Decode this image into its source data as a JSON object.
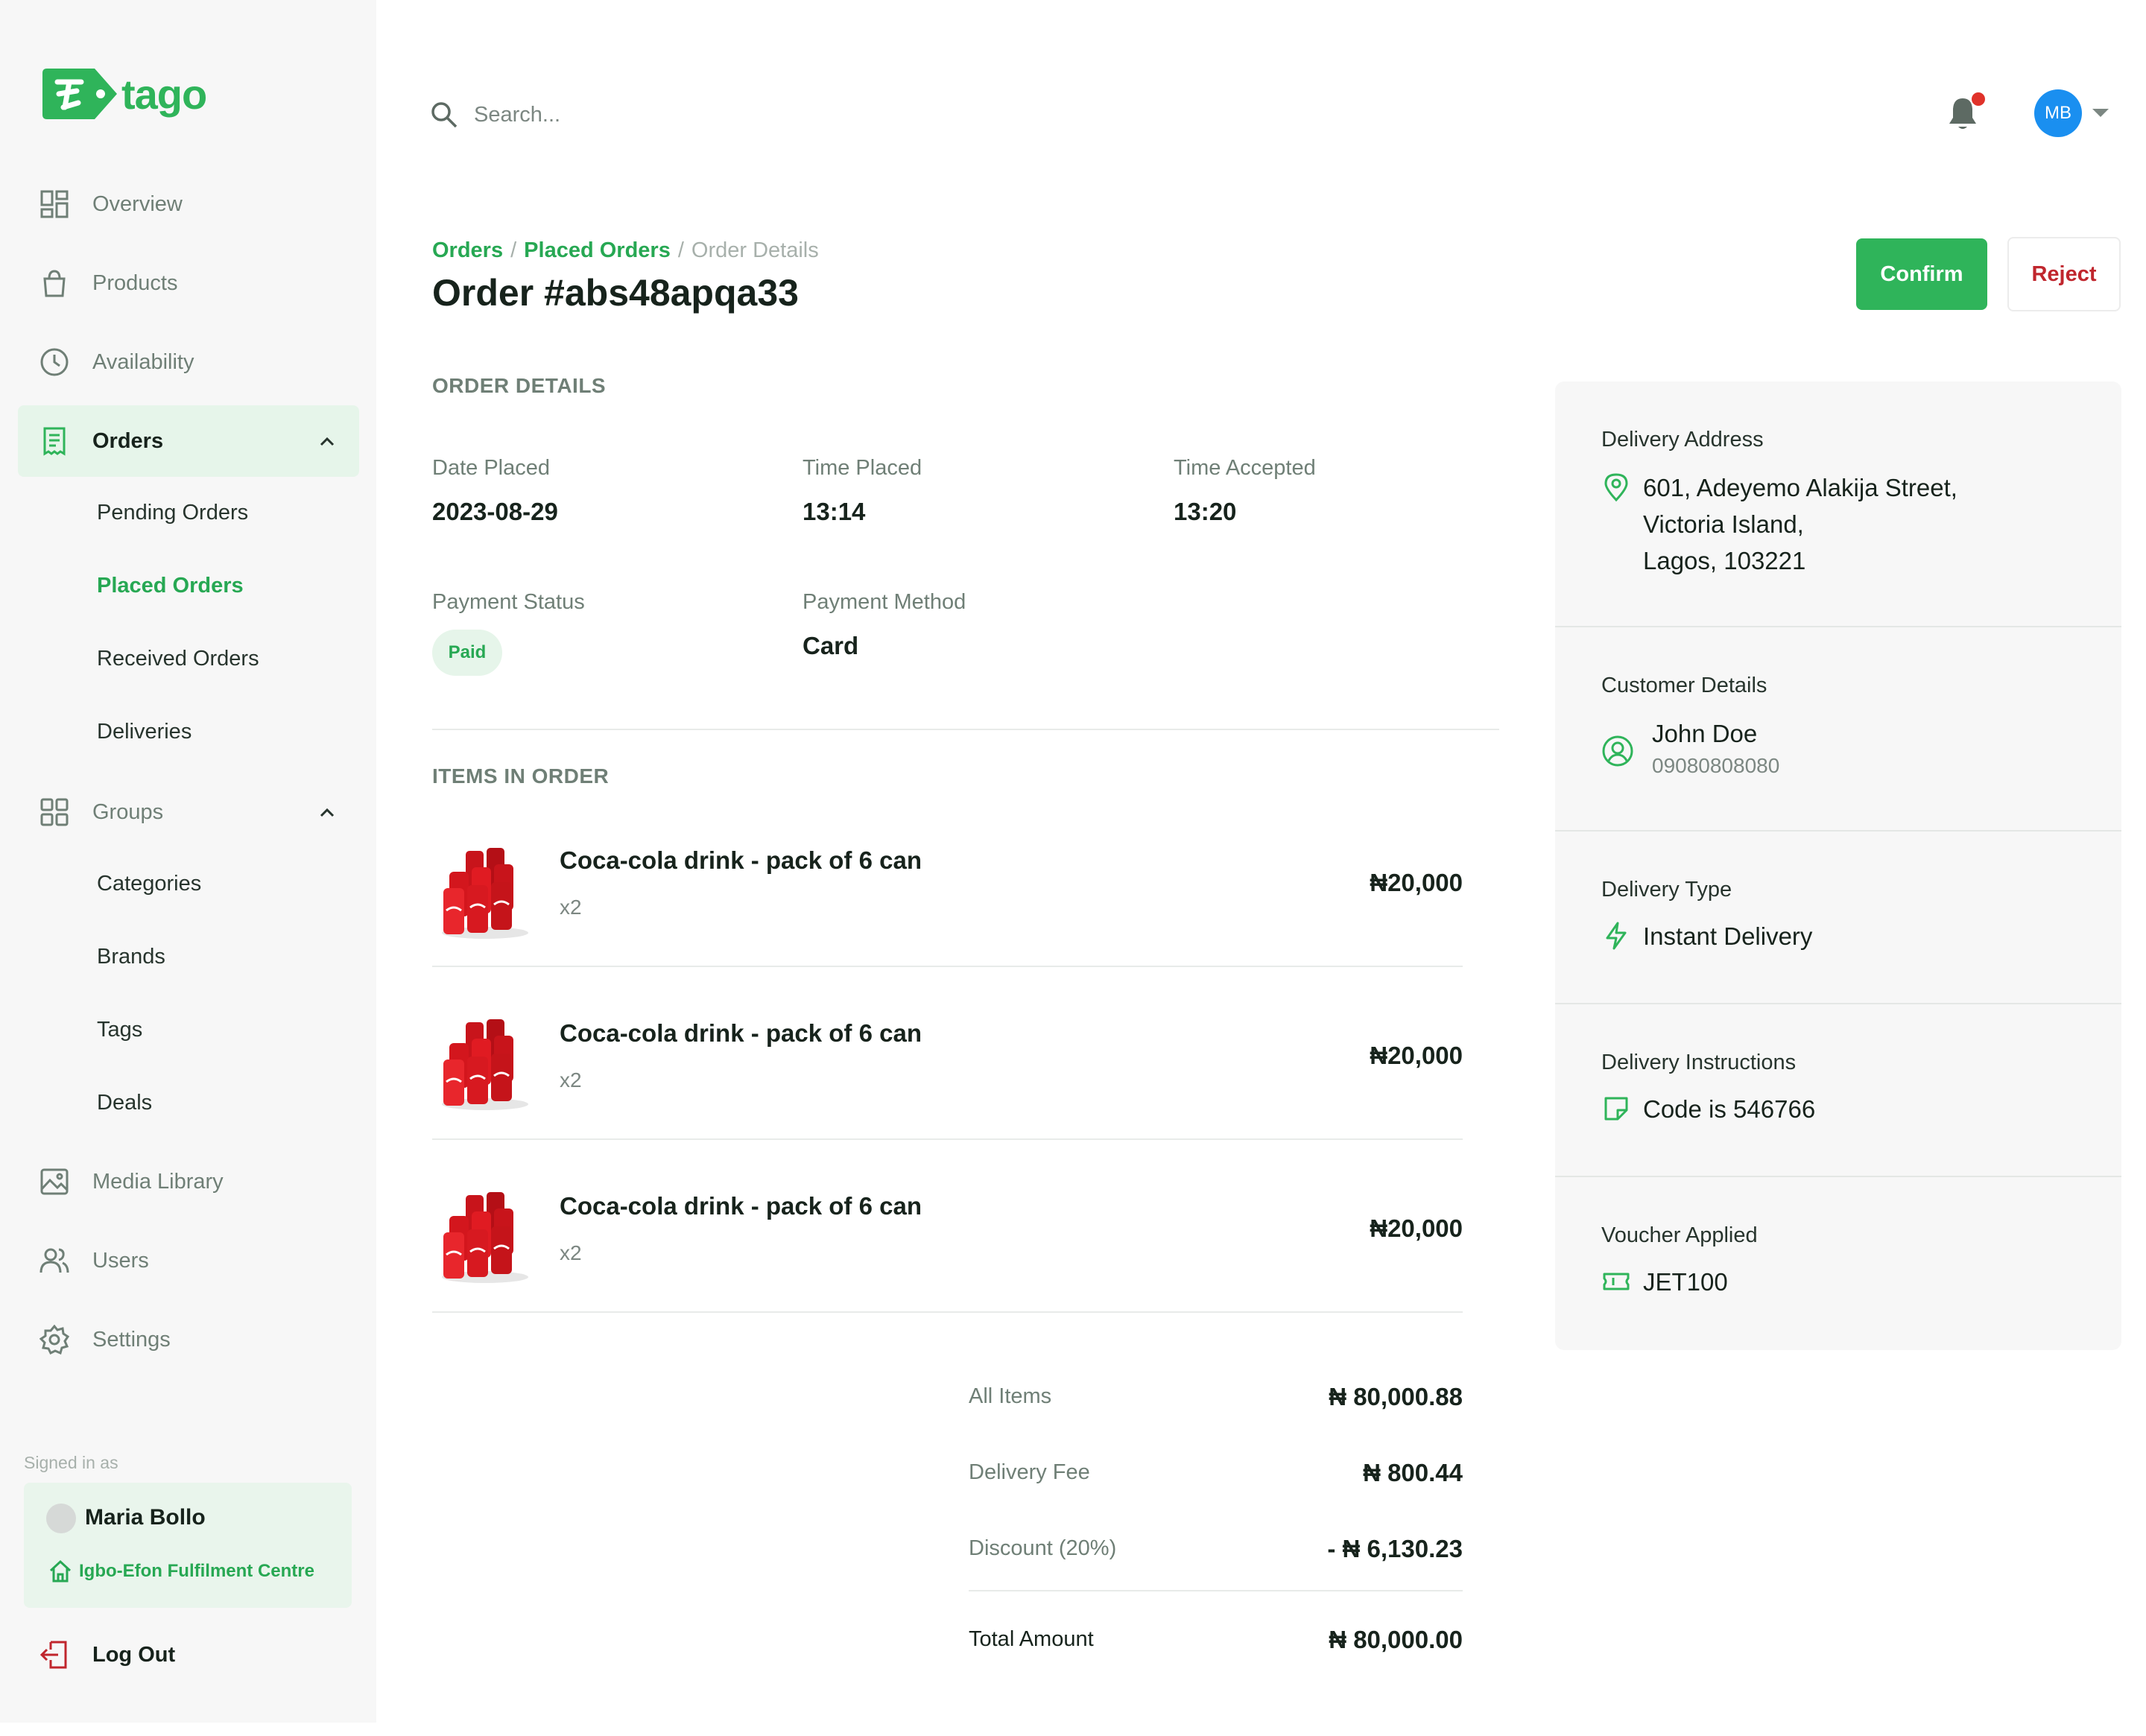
{
  "brand": {
    "name": "tago",
    "accent": "#2fb45a"
  },
  "sidebar": {
    "nav": [
      {
        "label": "Overview",
        "icon": "dashboard-icon"
      },
      {
        "label": "Products",
        "icon": "shopping-bag-icon"
      },
      {
        "label": "Availability",
        "icon": "clock-icon"
      },
      {
        "label": "Orders",
        "icon": "receipt-icon",
        "expanded": true
      },
      {
        "label": "Groups",
        "icon": "grid-icon",
        "expanded": true
      },
      {
        "label": "Media Library",
        "icon": "image-icon"
      },
      {
        "label": "Users",
        "icon": "users-icon"
      },
      {
        "label": "Settings",
        "icon": "gear-icon"
      }
    ],
    "orders_sub": [
      "Pending Orders",
      "Placed Orders",
      "Received Orders",
      "Deliveries"
    ],
    "groups_sub": [
      "Categories",
      "Brands",
      "Tags",
      "Deals"
    ],
    "signed_in_label": "Signed in as",
    "user_name": "Maria Bollo",
    "centre": "Igbo-Efon Fulfilment Centre",
    "logout": "Log Out"
  },
  "header": {
    "search_placeholder": "Search...",
    "avatar_initials": "MB",
    "has_notification": true
  },
  "breadcrumb": [
    "Orders",
    "Placed Orders",
    "Order Details"
  ],
  "page_title": "Order #abs48apqa33",
  "actions": {
    "confirm": "Confirm",
    "reject": "Reject"
  },
  "order_details": {
    "heading": "ORDER DETAILS",
    "date_placed_label": "Date Placed",
    "date_placed": "2023-08-29",
    "time_placed_label": "Time Placed",
    "time_placed": "13:14",
    "time_accepted_label": "Time Accepted",
    "time_accepted": "13:20",
    "payment_status_label": "Payment Status",
    "payment_status": "Paid",
    "payment_method_label": "Payment Method",
    "payment_method": "Card"
  },
  "items": {
    "heading": "ITEMS IN ORDER",
    "list": [
      {
        "name": "Coca-cola drink - pack of 6 can",
        "qty": "x2",
        "price": "₦20,000"
      },
      {
        "name": "Coca-cola drink - pack of 6 can",
        "qty": "x2",
        "price": "₦20,000"
      },
      {
        "name": "Coca-cola drink - pack of 6 can",
        "qty": "x2",
        "price": "₦20,000"
      }
    ]
  },
  "totals": {
    "all_items_label": "All Items",
    "all_items": "₦ 80,000.88",
    "delivery_fee_label": "Delivery Fee",
    "delivery_fee": "₦ 800.44",
    "discount_label": "Discount (20%)",
    "discount": "- ₦ 6,130.23",
    "total_label": "Total Amount",
    "total": "₦ 80,000.00"
  },
  "panel": {
    "address_label": "Delivery Address",
    "address_line1": "601, Adeyemo Alakija Street,",
    "address_line2": "Victoria Island,",
    "address_line3": "Lagos, 103221",
    "customer_label": "Customer Details",
    "customer_name": "John Doe",
    "customer_phone": "09080808080",
    "delivery_type_label": "Delivery Type",
    "delivery_type": "Instant Delivery",
    "instructions_label": "Delivery Instructions",
    "instructions": "Code is 546766",
    "voucher_label": "Voucher Applied",
    "voucher": "JET100"
  }
}
